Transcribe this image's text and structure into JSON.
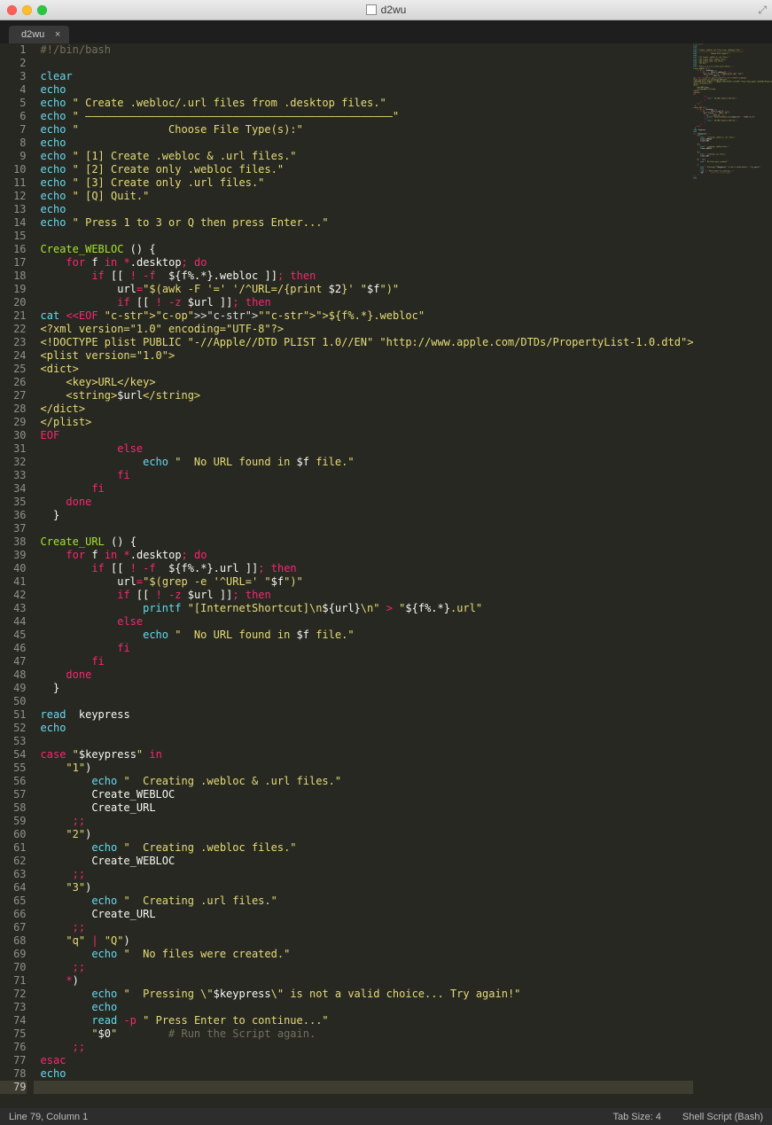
{
  "window": {
    "title": "d2wu"
  },
  "tab": {
    "label": "d2wu",
    "close_glyph": "×"
  },
  "statusbar": {
    "left": "Line 79, Column 1",
    "tab_size": "Tab Size: 4",
    "syntax": "Shell Script (Bash)"
  },
  "editor": {
    "current_line": 79,
    "lines": [
      "#!/bin/bash",
      "",
      "clear",
      "echo",
      "echo \" Create .webloc/.url files from .desktop files.\"",
      "echo \" ————————————————————————————————————————————————\"",
      "echo \"              Choose File Type(s):\"",
      "echo",
      "echo \" [1] Create .webloc & .url files.\"",
      "echo \" [2] Create only .webloc files.\"",
      "echo \" [3] Create only .url files.\"",
      "echo \" [Q] Quit.\"",
      "echo",
      "echo \" Press 1 to 3 or Q then press Enter...\"",
      "",
      "Create_WEBLOC () {",
      "    for f in *.desktop; do",
      "        if [[ ! -f  ${f%.*}.webloc ]]; then",
      "            url=\"$(awk -F '=' '/^URL=/{print $2}' \"$f\")\"",
      "            if [[ ! -z $url ]]; then",
      "cat <<EOF >\"${f%.*}.webloc\"",
      "<?xml version=\"1.0\" encoding=\"UTF-8\"?>",
      "<!DOCTYPE plist PUBLIC \"-//Apple//DTD PLIST 1.0//EN\" \"http://www.apple.com/DTDs/PropertyList-1.0.dtd\">",
      "<plist version=\"1.0\">",
      "<dict>",
      "    <key>URL</key>",
      "    <string>$url</string>",
      "</dict>",
      "</plist>",
      "EOF",
      "            else",
      "                echo \"  No URL found in $f file.\"",
      "            fi",
      "        fi",
      "    done",
      "  }",
      "",
      "Create_URL () {",
      "    for f in *.desktop; do",
      "        if [[ ! -f  ${f%.*}.url ]]; then",
      "            url=\"$(grep -e '^URL=' \"$f\")\"",
      "            if [[ ! -z $url ]]; then",
      "                printf \"[InternetShortcut]\\n${url}\\n\" > \"${f%.*}.url\"",
      "            else",
      "                echo \"  No URL found in $f file.\"",
      "            fi",
      "        fi",
      "    done",
      "  }",
      "",
      "read  keypress",
      "echo",
      "",
      "case \"$keypress\" in",
      "    \"1\")",
      "        echo \"  Creating .webloc & .url files.\"",
      "        Create_WEBLOC",
      "        Create_URL",
      "     ;;",
      "    \"2\")",
      "        echo \"  Creating .webloc files.\"",
      "        Create_WEBLOC",
      "     ;;",
      "    \"3\")",
      "        echo \"  Creating .url files.\"",
      "        Create_URL",
      "     ;;",
      "    \"q\" | \"Q\")",
      "        echo \"  No files were created.\"",
      "     ;;",
      "    *)",
      "        echo \"  Pressing \\\"$keypress\\\" is not a valid choice... Try again!\"",
      "        echo",
      "        read -p \" Press Enter to continue...\"",
      "        \"$0\"        # Run the Script again.",
      "     ;;",
      "esac",
      "echo",
      ""
    ]
  }
}
